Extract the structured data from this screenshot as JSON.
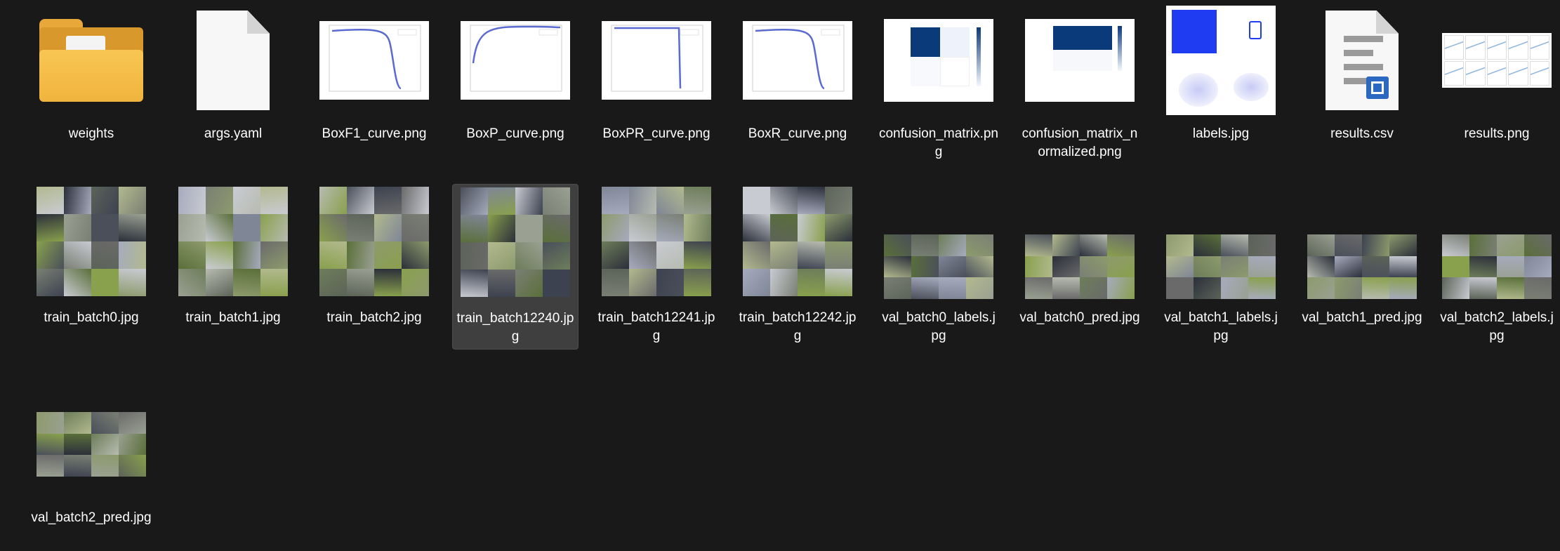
{
  "window": {
    "view": "large-icons"
  },
  "files": [
    {
      "name": "weights",
      "type": "folder",
      "selected": false
    },
    {
      "name": "args.yaml",
      "type": "document",
      "selected": false
    },
    {
      "name": "BoxF1_curve.png",
      "type": "curve-down",
      "selected": false
    },
    {
      "name": "BoxP_curve.png",
      "type": "curve-flat",
      "selected": false
    },
    {
      "name": "BoxPR_curve.png",
      "type": "curve-cliff",
      "selected": false
    },
    {
      "name": "BoxR_curve.png",
      "type": "curve-down",
      "selected": false
    },
    {
      "name": "confusion_matrix.png",
      "type": "confusion",
      "selected": false
    },
    {
      "name": "confusion_matrix_normalized.png",
      "type": "confusion-norm",
      "selected": false
    },
    {
      "name": "labels.jpg",
      "type": "labels",
      "selected": false
    },
    {
      "name": "results.csv",
      "type": "csv",
      "selected": false
    },
    {
      "name": "results.png",
      "type": "results",
      "selected": false
    },
    {
      "name": "train_batch0.jpg",
      "type": "mosaic-square",
      "selected": false
    },
    {
      "name": "train_batch1.jpg",
      "type": "mosaic-square",
      "selected": false
    },
    {
      "name": "train_batch2.jpg",
      "type": "mosaic-square",
      "selected": false
    },
    {
      "name": "train_batch12240.jpg",
      "type": "mosaic-square",
      "selected": true
    },
    {
      "name": "train_batch12241.jpg",
      "type": "mosaic-square",
      "selected": false
    },
    {
      "name": "train_batch12242.jpg",
      "type": "mosaic-square",
      "selected": false
    },
    {
      "name": "val_batch0_labels.jpg",
      "type": "mosaic-wide",
      "selected": false
    },
    {
      "name": "val_batch0_pred.jpg",
      "type": "mosaic-wide",
      "selected": false
    },
    {
      "name": "val_batch1_labels.jpg",
      "type": "mosaic-wide",
      "selected": false
    },
    {
      "name": "val_batch1_pred.jpg",
      "type": "mosaic-wide",
      "selected": false
    },
    {
      "name": "val_batch2_labels.jpg",
      "type": "mosaic-wide",
      "selected": false
    },
    {
      "name": "val_batch2_pred.jpg",
      "type": "mosaic-wide",
      "selected": false
    }
  ],
  "colors": {
    "background": "#191919",
    "selection": "#3f3f3f",
    "text": "#ffffff",
    "folder": "#f0b43d",
    "mosaic_palette": [
      "#7a7f74",
      "#9aa092",
      "#5c6358",
      "#b7bbb0",
      "#6d7d5a",
      "#8d9a6d",
      "#3d4250",
      "#a6abbd",
      "#4a4f5a",
      "#c9cbd2",
      "#5a6f3a",
      "#89a04d",
      "#2b2f3a",
      "#7f8696",
      "#b2b98e",
      "#6a6a6a"
    ]
  }
}
